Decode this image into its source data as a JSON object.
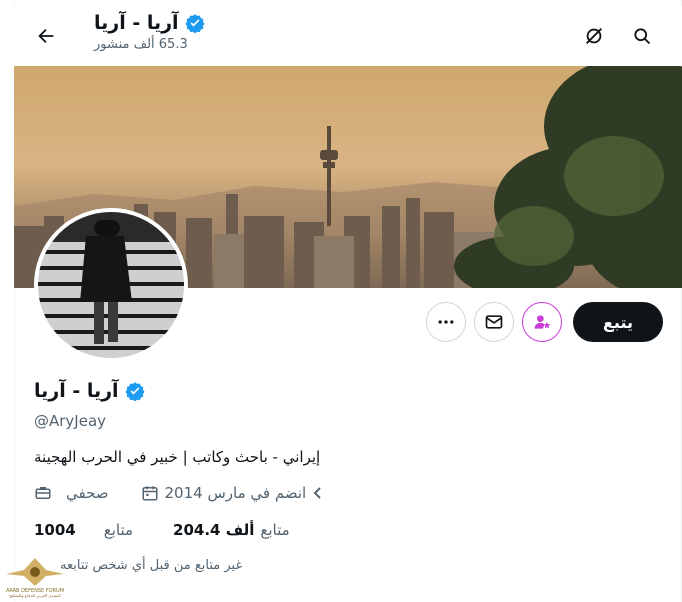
{
  "header": {
    "title": "آريا - آريا",
    "posts_count": "65.3 ألف منشور"
  },
  "profile": {
    "display_name": "آريا - آريا",
    "handle": "@AryJeay",
    "bio": "إيراني - باحث وكاتب | خبير في الحرب الهجينة",
    "category": "صحفي",
    "joined": "انضم في مارس 2014",
    "following_count": "1004",
    "following_label": "متابع",
    "followers_count": "204.4 ألف",
    "followers_label": "متابع",
    "not_followed_note": "غير متابع من قبل أي شخص تتابعه"
  },
  "actions": {
    "follow_label": "يتبع"
  },
  "colors": {
    "verified": "#1d9bf0",
    "subscribe_accent": "#c83cd8",
    "primary_text": "#0f1419",
    "secondary_text": "#536471"
  },
  "icons": [
    "back-arrow-icon",
    "search-icon",
    "grok-icon",
    "verified-badge-icon",
    "more-icon",
    "mail-icon",
    "subscribe-icon",
    "briefcase-icon",
    "calendar-icon",
    "chevron-icon"
  ],
  "watermark": {
    "title": "ARAB DEFENSE FORUM",
    "subtitle": "المنتدى العربي للدفاع والتسليح"
  }
}
